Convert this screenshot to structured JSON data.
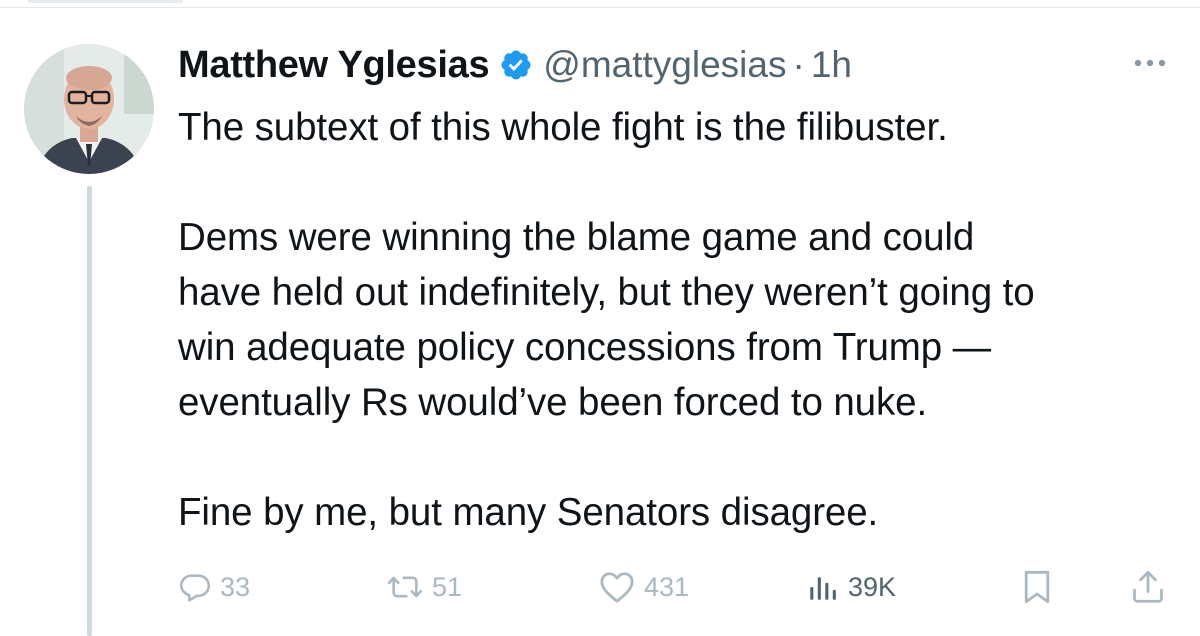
{
  "tweet": {
    "author_name": "Matthew Yglesias",
    "handle": "@mattyglesias",
    "separator": "·",
    "timestamp": "1h",
    "verified_icon": "verified-badge-icon",
    "text": {
      "line1": "The subtext of this whole fight is the filibuster.",
      "para2_line1": "Dems were winning the blame game and could",
      "para2_line2": "have held out indefinitely, but they weren’t going to",
      "para2_line3": "win adequate policy concessions from Trump —",
      "para2_line4": "eventually Rs would’ve been forced to nuke.",
      "para3_line1": "Fine by me, but many Senators disagree."
    },
    "actions": {
      "replies": "33",
      "retweets": "51",
      "likes": "431",
      "views": "39K"
    }
  },
  "icons": {
    "more": "more-options-icon",
    "reply": "reply-icon",
    "retweet": "retweet-icon",
    "like": "heart-icon",
    "views": "views-chart-icon",
    "bookmark": "bookmark-icon",
    "share": "share-icon"
  },
  "colors": {
    "text": "#0f1419",
    "secondary": "#536471",
    "faded_actions": "#aab8c2",
    "verified": "#1d9bf0",
    "thread_line": "#cfd9de"
  }
}
